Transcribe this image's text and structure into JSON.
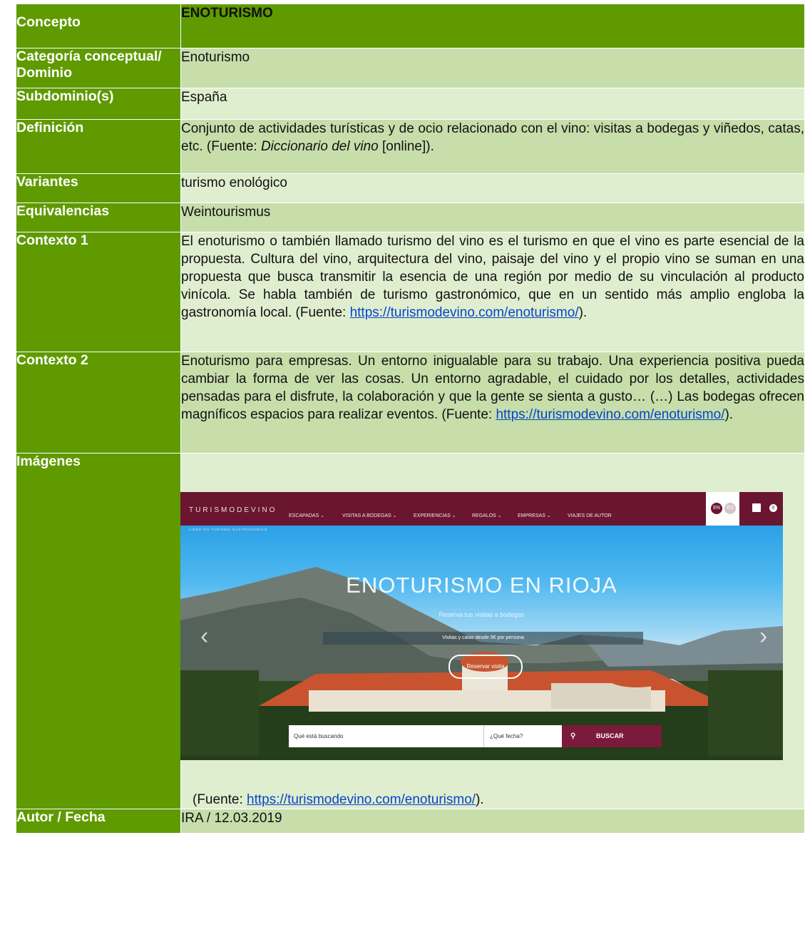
{
  "rows": [
    {
      "label": "Concepto",
      "value": "ENOTURISMO"
    },
    {
      "label": "Categoría conceptual/ Dominio",
      "value": "Enoturismo"
    },
    {
      "label": "Subdominio(s)",
      "value": "España"
    },
    {
      "label": "Definición",
      "value_pre": "Conjunto de actividades turísticas y de ocio relacionado con el vino: visitas a bodegas y viñedos, catas, etc. (Fuente: ",
      "value_em": "Diccionario del vino",
      "value_post": " [online])."
    },
    {
      "label": "Variantes",
      "value": "turismo enológico"
    },
    {
      "label": "Equivalencias",
      "value": "Weintourismus"
    },
    {
      "label": "Contexto 1",
      "value": "El enoturismo o también llamado turismo del vino es el turismo en que el vino es parte esencial de la propuesta. Cultura del vino, arquitectura del vino, paisaje del vino y el propio vino se suman en una propuesta que busca transmitir la esencia de una región por medio de su vinculación al producto vinícola. Se habla también de turismo gastronómico, que en un sentido más amplio engloba la gastronomía local. (Fuente: ",
      "link": "https://turismodevino.com/enoturismo/",
      "post": ")."
    },
    {
      "label": "Contexto 2",
      "value": "Enoturismo para empresas. Un entorno inigualable para su trabajo. Una experiencia positiva pueda cambiar la forma de ver las cosas. Un entorno agradable, el cuidado por los detalles, actividades pensadas para el disfrute, la colaboración y que la gente se sienta a gusto… (…) Las bodegas ofrecen magníficos espacios para realizar eventos. (Fuente: ",
      "link": "https://turismodevino.com/enoturismo/",
      "post": ")."
    },
    {
      "label": "Imágenes",
      "source_pre": "(Fuente: ",
      "link": "https://turismodevino.com/enoturismo/",
      "source_post": ")."
    },
    {
      "label": "Autor / Fecha",
      "value": "IRA / 12.03.2019"
    }
  ],
  "screenshot": {
    "brand": "TURISMODEVINO",
    "brand_sub": "LÍDER EN TURISMO GASTRONÓMICO",
    "nav": [
      "ESCAPADAS ⌄",
      "VISITAS A BODEGAS ⌄",
      "EXPERIENCIAS ⌄",
      "REGALOS ⌄",
      "EMPRESAS ⌄",
      "VIAJES DE AUTOR"
    ],
    "lang_en": "EN",
    "lang_es": "ES",
    "cart_count": "0",
    "hero_title": "ENOTURISMO EN RIOJA",
    "hero_subtitle": "Reserva tus visitas a bodegas",
    "hero_bar": "Visitas y catas desde 5€ por persona",
    "hero_button": "Reservar visita",
    "search_placeholder": "Qué está buscando",
    "date_placeholder": "¿Qué fecha?",
    "search_button": "BUSCAR",
    "colors": {
      "nav": "#6a1630",
      "button": "#7c1a3c"
    }
  },
  "colors": {
    "label_bg": "#5f9a00",
    "row_dark": "#c7deab",
    "row_light": "#e0eed0",
    "link": "#0645c8"
  }
}
